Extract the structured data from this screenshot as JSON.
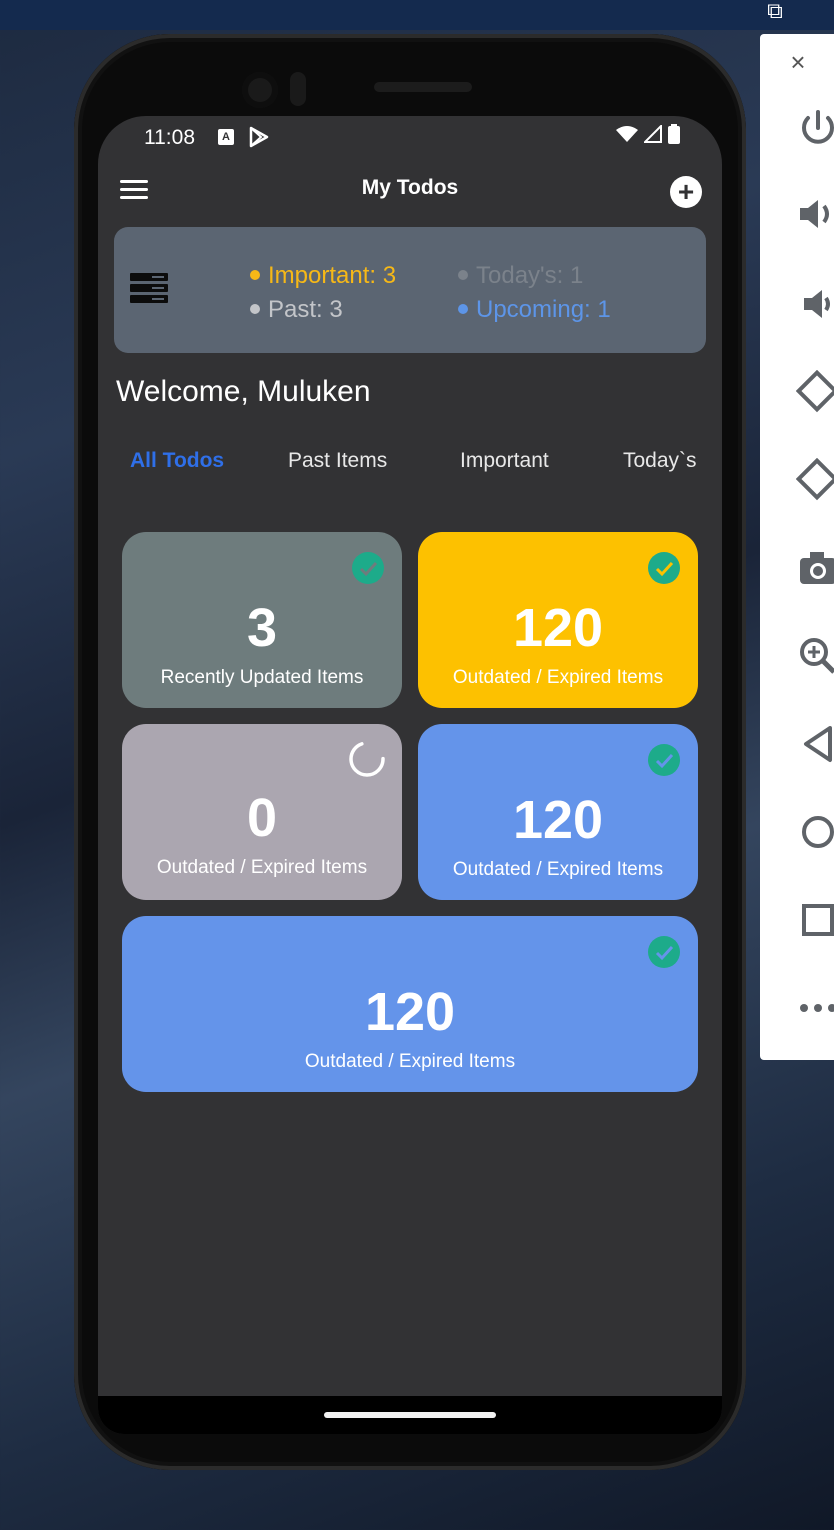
{
  "status_bar": {
    "time": "11:08",
    "notification_icons": [
      "a-icon",
      "play-store-icon"
    ],
    "system_icons": [
      "wifi-icon",
      "signal-icon",
      "battery-icon"
    ]
  },
  "app_bar": {
    "title": "My Todos",
    "menu_icon": "hamburger-menu-icon",
    "add_icon": "add-circle-icon"
  },
  "summary": {
    "icon": "list-icon",
    "important": "Important: 3",
    "todays": "Today's: 1",
    "past": "Past: 3",
    "upcoming": "Upcoming: 1",
    "colors": {
      "card": "#5b6572",
      "important": "#f6b817",
      "todays": "#7b828b",
      "past": "#c3c5c9",
      "upcoming": "#5d95e8"
    }
  },
  "welcome": "Welcome, Muluken",
  "tabs": [
    {
      "label": "All Todos",
      "active": true
    },
    {
      "label": "Past Items",
      "active": false
    },
    {
      "label": "Important",
      "active": false
    },
    {
      "label": "Today`s",
      "active": false
    }
  ],
  "tiles": [
    {
      "count": "3",
      "label": "Recently Updated Items",
      "color": "#6e7c7d",
      "status_icon": "check-circle-icon"
    },
    {
      "count": "120",
      "label": "Outdated / Expired Items",
      "color": "#fdc100",
      "status_icon": "check-circle-icon"
    },
    {
      "count": "0",
      "label": "Outdated / Expired Items",
      "color": "#aba6b0",
      "status_icon": "loading-spinner-icon"
    },
    {
      "count": "120",
      "label": "Outdated / Expired Items",
      "color": "#6494ea",
      "status_icon": "check-circle-icon"
    },
    {
      "count": "120",
      "label": "Outdated / Expired Items",
      "color": "#6494ea",
      "status_icon": "check-circle-icon"
    }
  ],
  "emulator_toolbar": {
    "close_icon": "close-icon",
    "buttons": [
      "power-icon",
      "volume-up-icon",
      "volume-down-icon",
      "rotate-left-icon",
      "rotate-right-icon",
      "camera-icon",
      "zoom-icon",
      "back-icon",
      "home-icon",
      "overview-icon",
      "more-icon"
    ]
  },
  "accent": "#2f6fe8"
}
